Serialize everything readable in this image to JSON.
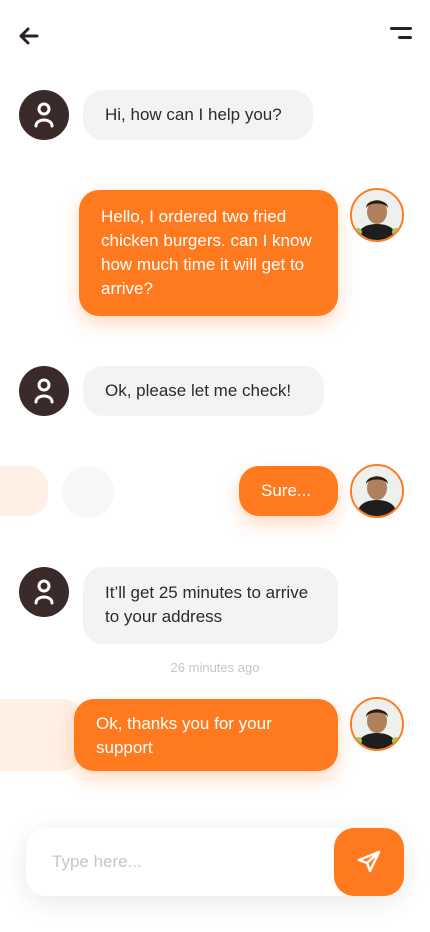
{
  "colors": {
    "accent": "#ff7a1f",
    "bot_avatar": "#3a2a2a",
    "incoming_bubble": "#f2f3f5",
    "background": "#ffffff"
  },
  "header": {
    "back_icon": "arrow-left-icon",
    "menu_icon": "menu-icon"
  },
  "messages": [
    {
      "from": "bot",
      "text": "Hi, how can I help you?"
    },
    {
      "from": "user",
      "text": "Hello, I ordered two fried chicken burgers. can I know how much time it will get to arrive?"
    },
    {
      "from": "bot",
      "text": "Ok, please let me check!"
    },
    {
      "from": "user",
      "text": "Sure..."
    },
    {
      "from": "bot",
      "text": "It’ll get 25 minutes to arrive to your address"
    },
    {
      "from": "user",
      "text": "Ok, thanks you for your support"
    }
  ],
  "timestamp": "26 minutes ago",
  "composer": {
    "placeholder": "Type here...",
    "send_icon": "paper-plane-icon"
  }
}
